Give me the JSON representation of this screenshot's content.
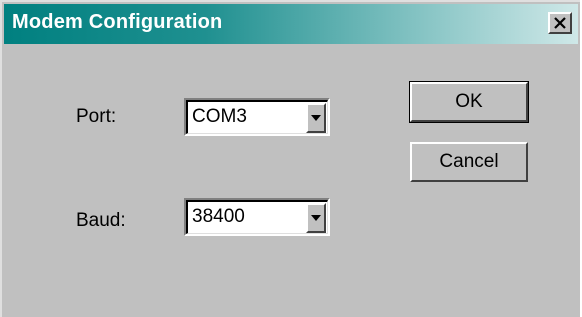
{
  "window": {
    "title": "Modem Configuration",
    "close_icon": "close-x-icon"
  },
  "form": {
    "port": {
      "label": "Port:",
      "value": "COM3"
    },
    "baud": {
      "label": "Baud:",
      "value": "38400"
    }
  },
  "buttons": {
    "ok_label": "OK",
    "cancel_label": "Cancel"
  },
  "colors": {
    "titlebar_start": "#008080",
    "dialog_face": "#c0c0c0"
  }
}
